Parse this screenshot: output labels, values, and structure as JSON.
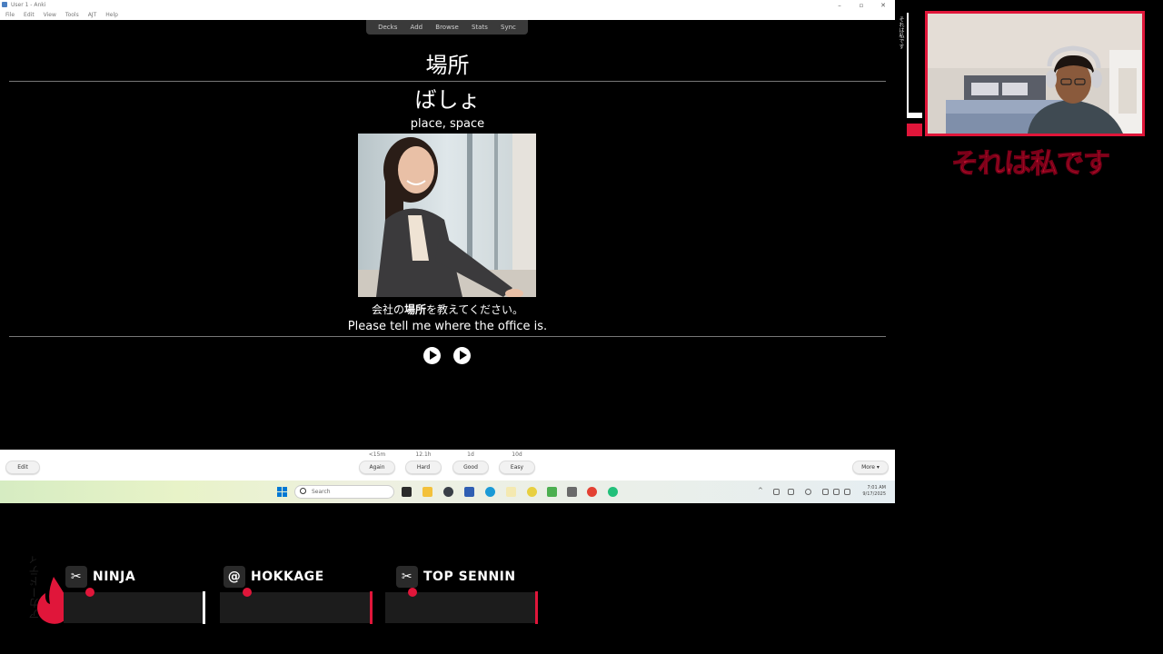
{
  "window": {
    "title": "User 1 - Anki",
    "menus": [
      "File",
      "Edit",
      "View",
      "Tools",
      "AJT",
      "Help"
    ],
    "controls": [
      "–",
      "▫",
      "✕"
    ]
  },
  "toolbar": {
    "items": [
      "Decks",
      "Add",
      "Browse",
      "Stats",
      "Sync"
    ]
  },
  "card": {
    "front": "場所",
    "reading": "ばしょ",
    "meaning": "place, space",
    "sentence_jp_pre": "会社の",
    "sentence_jp_bold": "場所",
    "sentence_jp_post": "を教えてください。",
    "sentence_en": "Please tell me where the office is."
  },
  "review": {
    "edit_label": "Edit",
    "more_label": "More ▾",
    "buttons": [
      {
        "label": "Again",
        "interval": "<15m"
      },
      {
        "label": "Hard",
        "interval": "12.1h"
      },
      {
        "label": "Good",
        "interval": "1d"
      },
      {
        "label": "Easy",
        "interval": "10d"
      }
    ]
  },
  "taskbar": {
    "search_placeholder": "Search",
    "clock_time": "7:01 AM",
    "clock_date": "9/17/2025",
    "colors": {
      "windows": "#0078d4"
    }
  },
  "overlay": {
    "webcam_caption": "それは私です",
    "side_label": "それは私です",
    "vertical_label": "アカードティ",
    "accent_color": "#e0163a",
    "ranks": [
      {
        "name": "NINJA",
        "icon": "crossed-kunai-icon"
      },
      {
        "name": "HOKKAGE",
        "icon": "leaf-village-icon"
      },
      {
        "name": "TOP SENNIN",
        "icon": "crossed-kunai-icon"
      }
    ]
  }
}
